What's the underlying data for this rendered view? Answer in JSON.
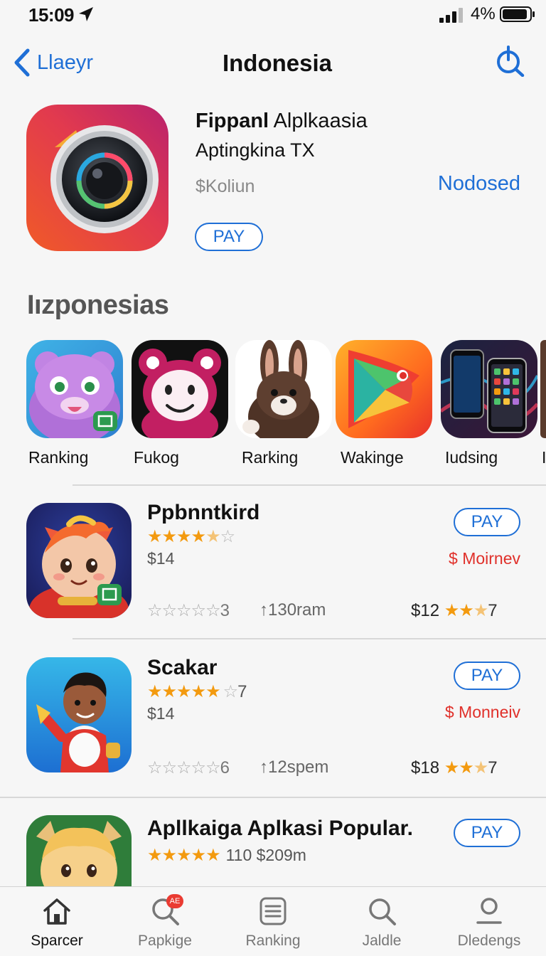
{
  "status_bar": {
    "time": "15:09",
    "battery_text": "4%"
  },
  "nav": {
    "back_label": "Llaeyr",
    "title": "Indonesia"
  },
  "featured": {
    "name_bold": "Fippanl",
    "name_rest": "Alplkaasia",
    "subtitle": "Aptingkina TX",
    "price": "$Koliun",
    "status": "Nodosed",
    "pay_label": "PAY"
  },
  "section": {
    "title": "Iızponesias",
    "categories": [
      {
        "label": "Ranking"
      },
      {
        "label": "Fukog"
      },
      {
        "label": "Rarking"
      },
      {
        "label": "Wakinge"
      },
      {
        "label": "Iudsing"
      },
      {
        "label": "I"
      }
    ]
  },
  "apps": [
    {
      "name": "Ppbnntkird",
      "rating": 4.5,
      "price": "$14",
      "offer": "$ Moirnev",
      "pay_label": "PAY",
      "empty_stars_count": "3",
      "size": "130ram",
      "price2": "$12",
      "rating2_count": "7"
    },
    {
      "name": "Scakar",
      "rating": 5,
      "rating_count": "7",
      "price": "$14",
      "offer": "$ Monneiv",
      "pay_label": "PAY",
      "empty_stars_count": "6",
      "size": "12spem",
      "price2": "$18",
      "rating2_count": "7"
    },
    {
      "name": "Apllkaiga Aplkasi Popular.",
      "rating": 5,
      "extra": "110  $209m",
      "pay_label": "PAY"
    }
  ],
  "tabs": [
    {
      "label": "Sparcer",
      "icon": "home-icon",
      "active": true
    },
    {
      "label": "Papkige",
      "icon": "search-icon",
      "badge": "AE"
    },
    {
      "label": "Ranking",
      "icon": "list-icon"
    },
    {
      "label": "Jaldle",
      "icon": "search-icon"
    },
    {
      "label": "Dledengs",
      "icon": "person-icon"
    }
  ],
  "colors": {
    "accent": "#1f6fd6",
    "star": "#f39a0f",
    "offer": "#e0302a",
    "badge": "#ea3b32"
  }
}
